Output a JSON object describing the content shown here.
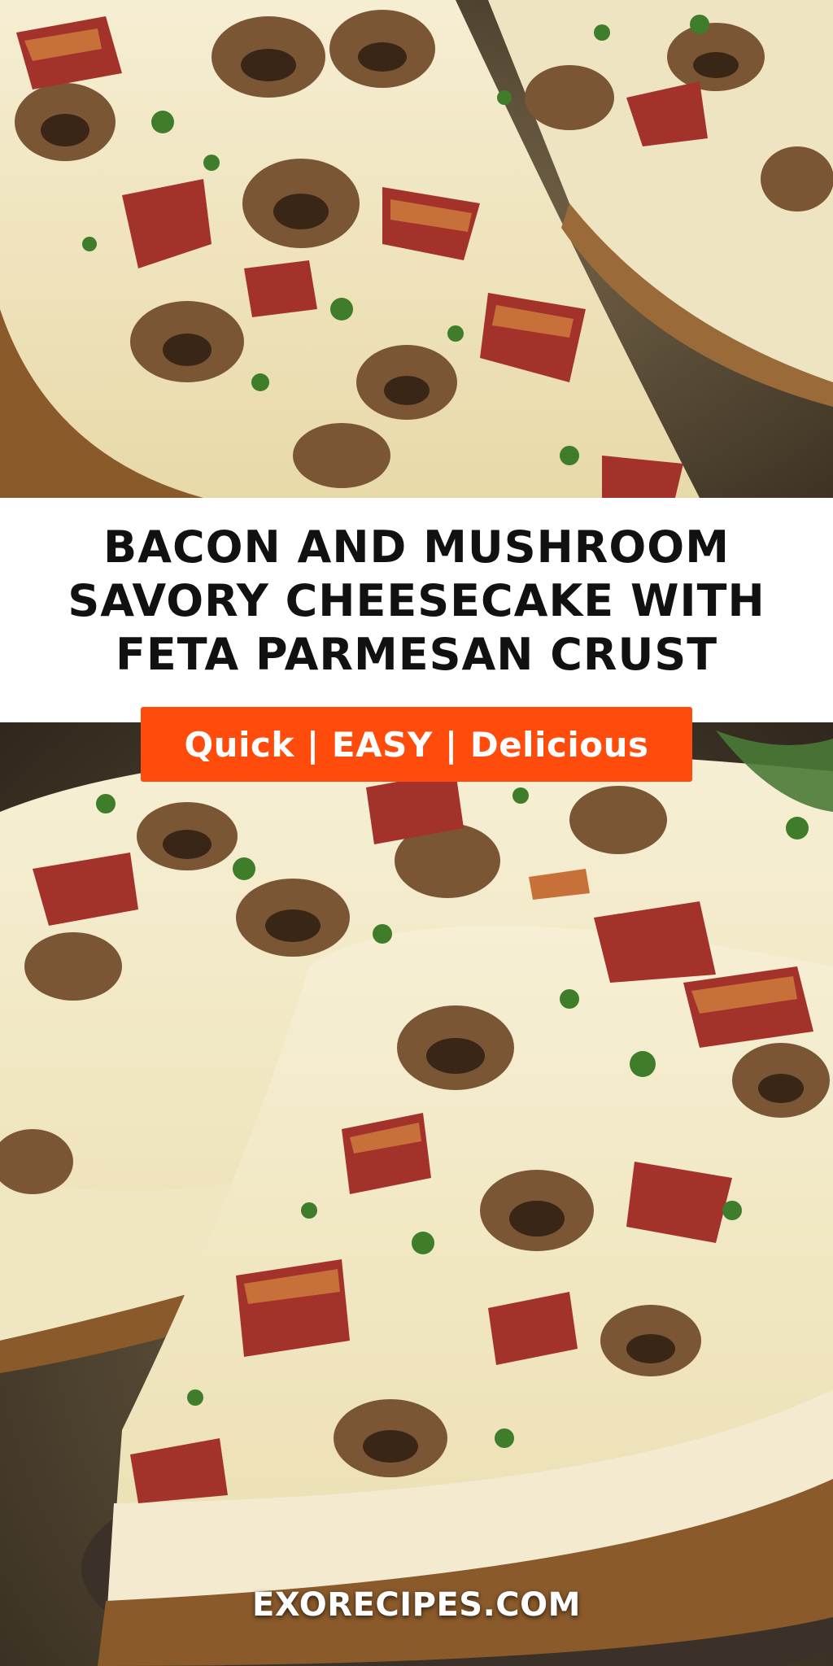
{
  "title": "BACON AND MUSHROOM SAVORY CHEESECAKE WITH FETA PARMESAN CRUST",
  "tagline": "Quick | EASY | Delicious",
  "site": "EXORECIPES.COM",
  "colors": {
    "badge": "#ff4c0d",
    "title_text": "#111111",
    "cheese": "#f0e6c2",
    "crust": "#8a5a2b",
    "bacon": "#a3322a",
    "mushroom": "#7a5634",
    "parsley": "#3f7d2a"
  }
}
